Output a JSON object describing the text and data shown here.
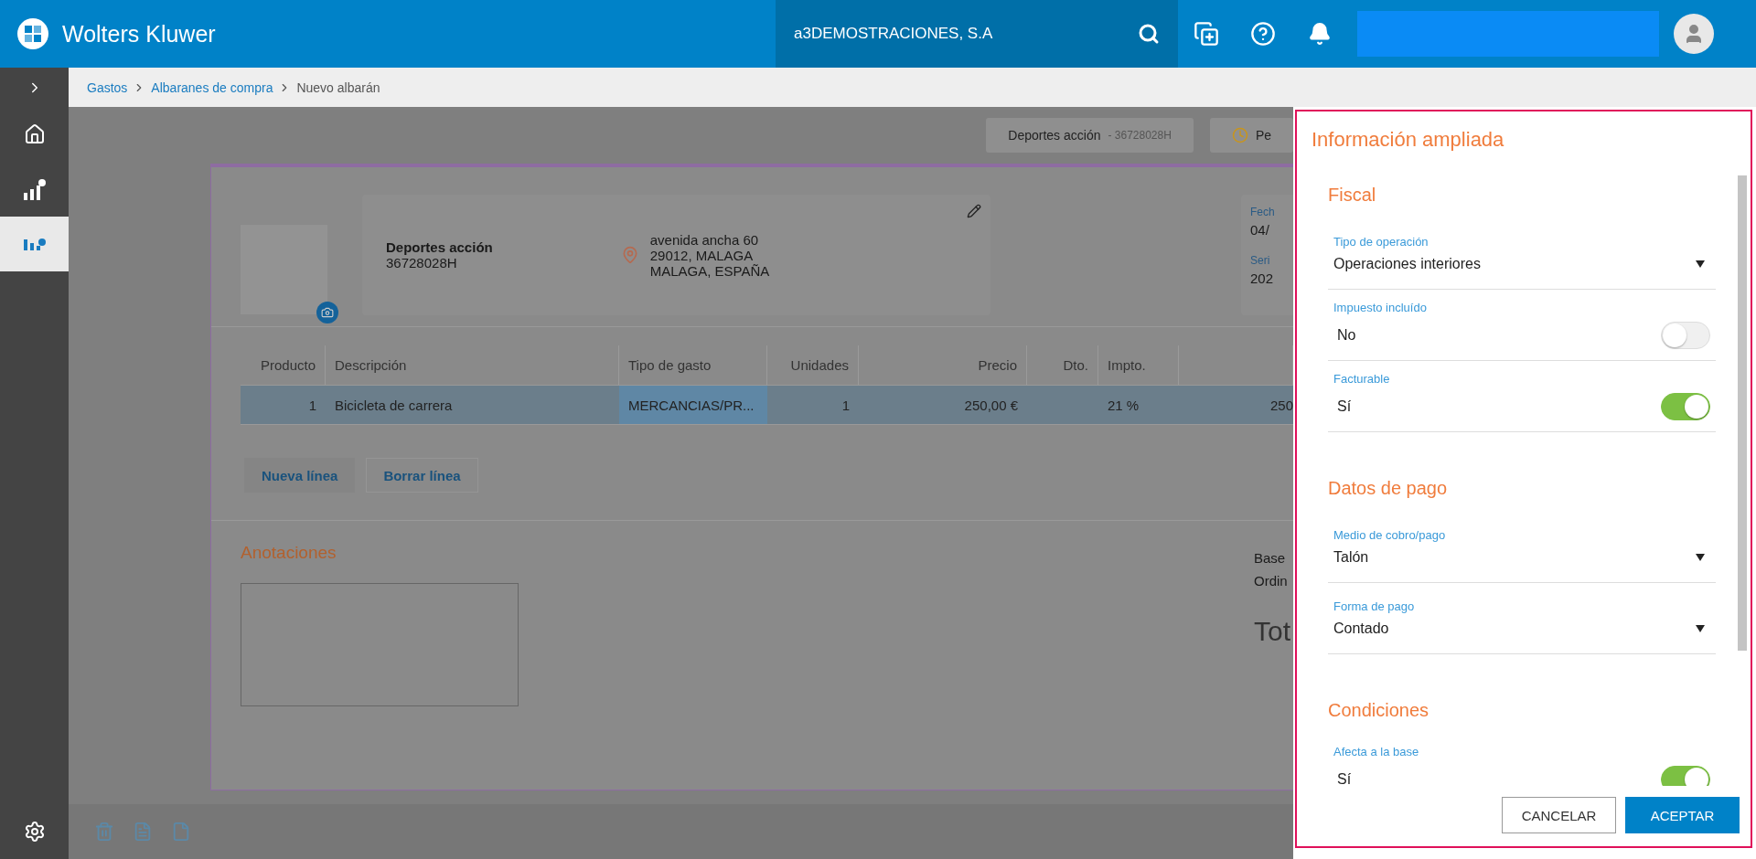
{
  "header": {
    "brand": "Wolters Kluwer",
    "company": "a3DEMOSTRACIONES, S.A"
  },
  "breadcrumb": [
    {
      "label": "Gastos",
      "link": true
    },
    {
      "label": "Albaranes de compra",
      "link": true
    },
    {
      "label": "Nuevo albarán",
      "link": false
    }
  ],
  "sidebar_items": [
    {
      "kind": "home",
      "selected": false
    },
    {
      "kind": "chart-up",
      "selected": false
    },
    {
      "kind": "chart-down",
      "selected": true
    }
  ],
  "chips": [
    {
      "label": "Deportes acción",
      "detail": "- 36728028H",
      "kind": "contact"
    },
    {
      "label": "Pe",
      "kind": "clock"
    }
  ],
  "supplier": {
    "name": "Deportes acción",
    "tax_id": "36728028H",
    "address": [
      "avenida ancha 60",
      "29012, MALAGA",
      "MALAGA, ESPAÑA"
    ]
  },
  "side_fields": [
    {
      "label": "Fech",
      "value": "04/"
    },
    {
      "label": "Seri",
      "value": "202"
    }
  ],
  "table": {
    "columns": [
      "Producto",
      "Descripción",
      "Tipo de gasto",
      "Unidades",
      "Precio",
      "Dto.",
      "Impto."
    ],
    "rows": [
      {
        "selected": true,
        "producto": "1",
        "descripcion": "Bicicleta de carrera",
        "tipo_de_gasto": "MERCANCIAS/PR...",
        "unidades": "1",
        "precio": "250,00 €",
        "impto": "21 %",
        "column_8": "250"
      }
    ]
  },
  "line_buttons": [
    "Nueva línea",
    "Borrar línea"
  ],
  "notes": {
    "title": "Anotaciones"
  },
  "totals": {
    "lines": [
      "Base",
      "Ordin"
    ],
    "total": "Tot"
  },
  "panel": {
    "title": "Información ampliada",
    "sections": [
      {
        "title": "Fiscal",
        "fields": [
          {
            "kind": "select",
            "label": "Tipo de operación",
            "value": "Operaciones interiores"
          },
          {
            "kind": "switch",
            "label": "Impuesto incluído",
            "value": "No",
            "on": false
          },
          {
            "kind": "switch",
            "label": "Facturable",
            "value": "Sí",
            "on": true
          }
        ]
      },
      {
        "title": "Datos de pago",
        "fields": [
          {
            "kind": "select",
            "label": "Medio de cobro/pago",
            "value": "Talón"
          },
          {
            "kind": "select",
            "label": "Forma de pago",
            "value": "Contado"
          }
        ]
      },
      {
        "title": "Condiciones",
        "fields": [
          {
            "kind": "switch",
            "label": "Afecta a la base",
            "value": "Sí",
            "on": true
          }
        ]
      }
    ],
    "buttons": [
      {
        "label": "CANCELAR",
        "primary": false
      },
      {
        "label": "ACEPTAR",
        "primary": true
      }
    ]
  }
}
